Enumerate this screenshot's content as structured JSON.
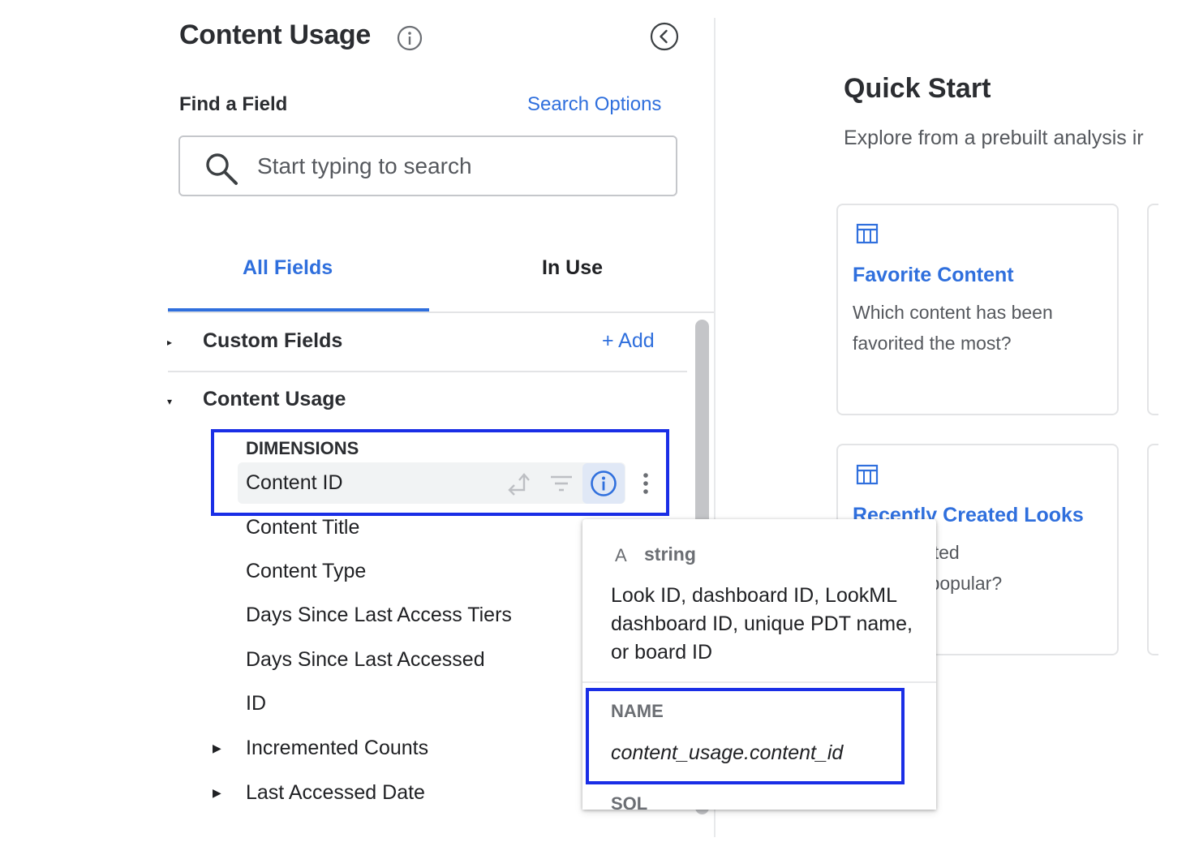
{
  "sidebar": {
    "title": "Content Usage",
    "find_field_label": "Find a Field",
    "search_options_label": "Search Options",
    "search": {
      "placeholder": "Start typing to search",
      "value": ""
    },
    "tabs": [
      {
        "label": "All Fields",
        "active": true
      },
      {
        "label": "In Use",
        "active": false
      }
    ],
    "custom_fields": {
      "label": "Custom Fields",
      "add_label": "+ Add"
    },
    "view": {
      "label": "Content Usage",
      "dimensions_label": "DIMENSIONS",
      "selected_field": "Content ID",
      "fields": [
        {
          "label": "Content Title",
          "expandable": false
        },
        {
          "label": "Content Type",
          "expandable": false
        },
        {
          "label": "Days Since Last Access Tiers",
          "expandable": false
        },
        {
          "label": "Days Since Last Accessed",
          "expandable": false
        },
        {
          "label": "ID",
          "expandable": false
        },
        {
          "label": "Incremented Counts",
          "expandable": true
        },
        {
          "label": "Last Accessed Date",
          "expandable": true
        }
      ]
    }
  },
  "quick_start": {
    "title": "Quick Start",
    "subtitle": "Explore from a prebuilt analysis ir",
    "cards": [
      {
        "title": "Favorite Content",
        "description": "Which content has been favorited the most?"
      },
      {
        "title": "Recently Created Looks",
        "description": "ently created\n the most popular?"
      }
    ]
  },
  "tooltip": {
    "type_icon": "A",
    "type": "string",
    "description": "Look ID, dashboard ID, LookML dashboard ID, unique PDT name, or board ID",
    "name_label": "NAME",
    "name_value": "content_usage.content_id",
    "sql_label": "SQL"
  },
  "colors": {
    "accent": "#2f6fdd",
    "highlight_box": "#1a2ee6",
    "selected_row": "#f1f3f4"
  }
}
